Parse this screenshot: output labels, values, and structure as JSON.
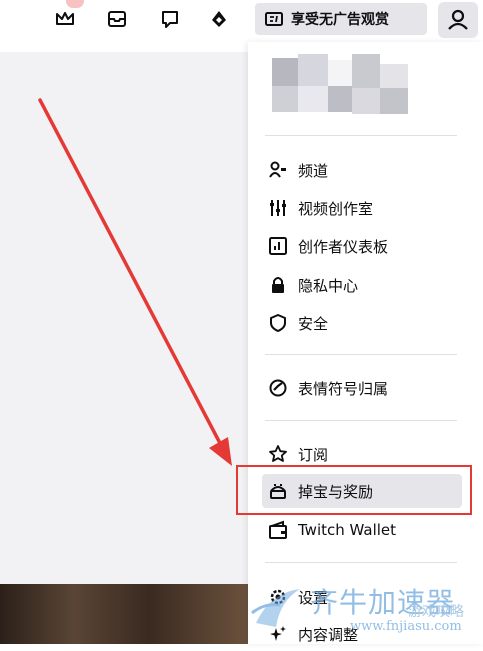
{
  "topbar": {
    "adfree_label": "享受无广告观赏",
    "icons": [
      "crown-icon",
      "inbox-icon",
      "whisper-icon",
      "bits-icon",
      "ad-free-icon",
      "user-icon"
    ]
  },
  "menu": {
    "group1": [
      {
        "label": "频道",
        "icon": "channel-icon"
      },
      {
        "label": "视频创作室",
        "icon": "creator-studio-icon"
      },
      {
        "label": "创作者仪表板",
        "icon": "dashboard-icon"
      },
      {
        "label": "隐私中心",
        "icon": "lock-icon"
      },
      {
        "label": "安全",
        "icon": "shield-icon"
      }
    ],
    "group2": [
      {
        "label": "表情符号归属",
        "icon": "emote-icon"
      }
    ],
    "group3": [
      {
        "label": "订阅",
        "icon": "star-icon"
      },
      {
        "label": "掉宝与奖励",
        "icon": "drops-icon"
      },
      {
        "label": "Twitch Wallet",
        "icon": "wallet-icon"
      }
    ],
    "group4": [
      {
        "label": "设置",
        "icon": "gear-icon"
      },
      {
        "label": "内容调整",
        "icon": "sparkle-icon"
      }
    ]
  },
  "watermark": {
    "main": "齐牛加速器",
    "sub": "www.fnjiasu.com",
    "overlay": "游戏攻略"
  },
  "colors": {
    "annotation_red": "#e53935",
    "highlight_bg": "#e6e6ea",
    "watermark_blue": "#6ea8dd"
  }
}
